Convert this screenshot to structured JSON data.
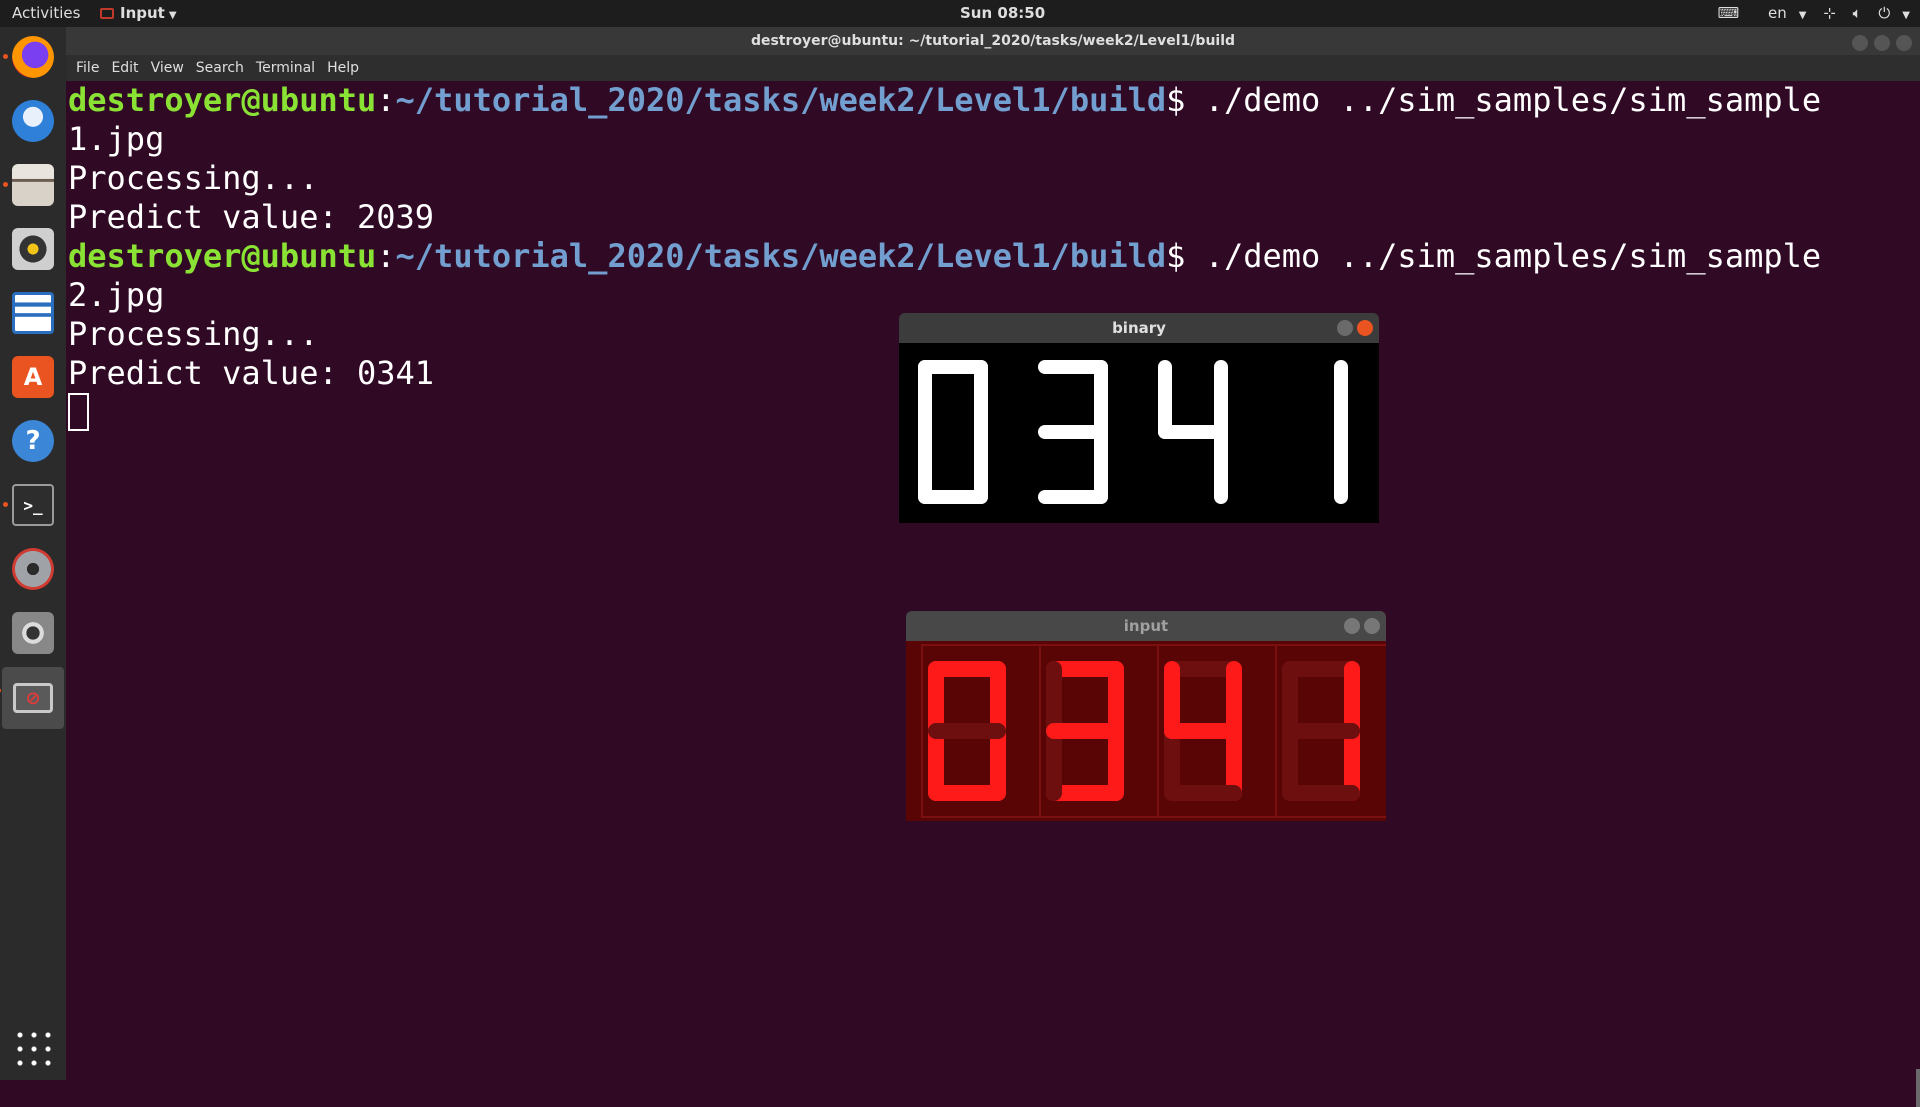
{
  "topbar": {
    "activities": "Activities",
    "app_menu": "Input",
    "clock": "Sun 08:50",
    "language": "en"
  },
  "dock": {
    "items": [
      "firefox-icon",
      "thunderbird-icon",
      "files-icon",
      "rhythmbox-icon",
      "libreoffice-writer-icon",
      "ubuntu-software-icon",
      "help-icon",
      "terminal-icon",
      "settings-icon",
      "screenshot-icon",
      "opencv-window-icon"
    ],
    "show_apps": "show-applications-icon"
  },
  "terminal": {
    "title": "destroyer@ubuntu: ~/tutorial_2020/tasks/week2/Level1/build",
    "menu": [
      "File",
      "Edit",
      "View",
      "Search",
      "Terminal",
      "Help"
    ],
    "session": [
      {
        "user": "destroyer@ubuntu",
        "path": "~/tutorial_2020/tasks/week2/Level1/build",
        "command": "./demo ../sim_samples/sim_sample",
        "wrap": "1.jpg",
        "output": [
          "Processing...",
          "Predict value: 2039"
        ]
      },
      {
        "user": "destroyer@ubuntu",
        "path": "~/tutorial_2020/tasks/week2/Level1/build",
        "command": "./demo ../sim_samples/sim_sample",
        "wrap": "2.jpg",
        "output": [
          "Processing...",
          "Predict value: 0341"
        ]
      }
    ]
  },
  "windows": {
    "binary": {
      "title": "binary",
      "digits": "0341"
    },
    "input": {
      "title": "input",
      "digits": "0341"
    }
  },
  "colors": {
    "terminal_bg": "#300a24",
    "prompt_user": "#8ae234",
    "prompt_path": "#729fcf",
    "segment_on": "#ff1a1a",
    "segment_off": "#6e0f0f",
    "accent": "#e95420"
  }
}
